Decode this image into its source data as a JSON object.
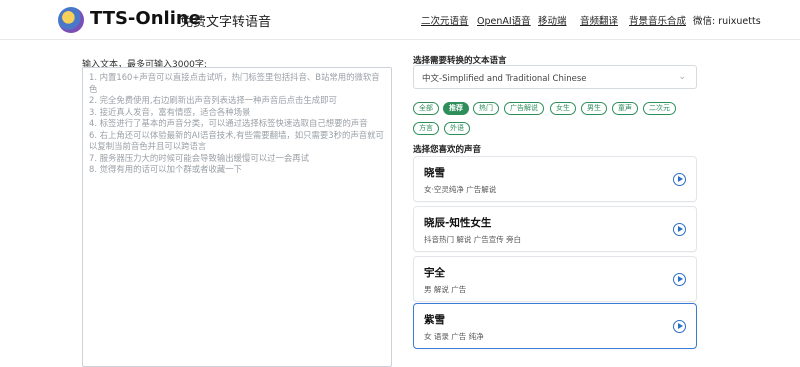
{
  "header": {
    "brand": "TTS-Online",
    "subtitle": "免费文字转语音",
    "nav": [
      "二次元语音",
      "OpenAI语音",
      "移动端",
      "音频翻译",
      "背景音乐合成"
    ],
    "wechat": "微信: ruixuetts"
  },
  "input": {
    "label": "输入文本，最多可输入3000字:",
    "hints": [
      "1. 内置160+声音可以直接点击试听，热门标签里包括抖音、B站常用的微软音色",
      "2. 完全免费使用,右边刷新出声音列表选择一种声音后点击生成即可",
      "3. 接近真人发音，富有情感，适合各种场景",
      "4. 标签进行了基本的声音分类，可以通过选择标签快速选取自己想要的声音",
      "6. 右上角还可以体验最新的AI语音技术,有些需要翻墙，如只需要3秒的声音就可以复制当前音色并且可以跨语言",
      "7. 服务器压力大的时候可能会导致输出缓慢可以过一会再试",
      "8. 觉得有用的话可以加个群或者收藏一下"
    ]
  },
  "language": {
    "label": "选择需要转换的文本语言",
    "value": "中文-Simplified and Traditional Chinese"
  },
  "tags": [
    "全部",
    "推荐",
    "热门",
    "广告解说",
    "女生",
    "男生",
    "童声",
    "二次元",
    "方言",
    "外语"
  ],
  "active_tag": "推荐",
  "voices": {
    "label": "选择您喜欢的声音",
    "items": [
      {
        "name": "晓雪",
        "desc": "女·空灵纯净 广告解说"
      },
      {
        "name": "晓辰-知性女生",
        "desc": "抖音热门 解说 广告宣传 旁白"
      },
      {
        "name": "宇全",
        "desc": "男 解说 广告"
      },
      {
        "name": "紫雪",
        "desc": "女 语录 广告 纯净"
      }
    ]
  },
  "colors": {
    "accent": "#2e8f5b",
    "play": "#2a6fc9",
    "selected": "#3a7bd5"
  }
}
